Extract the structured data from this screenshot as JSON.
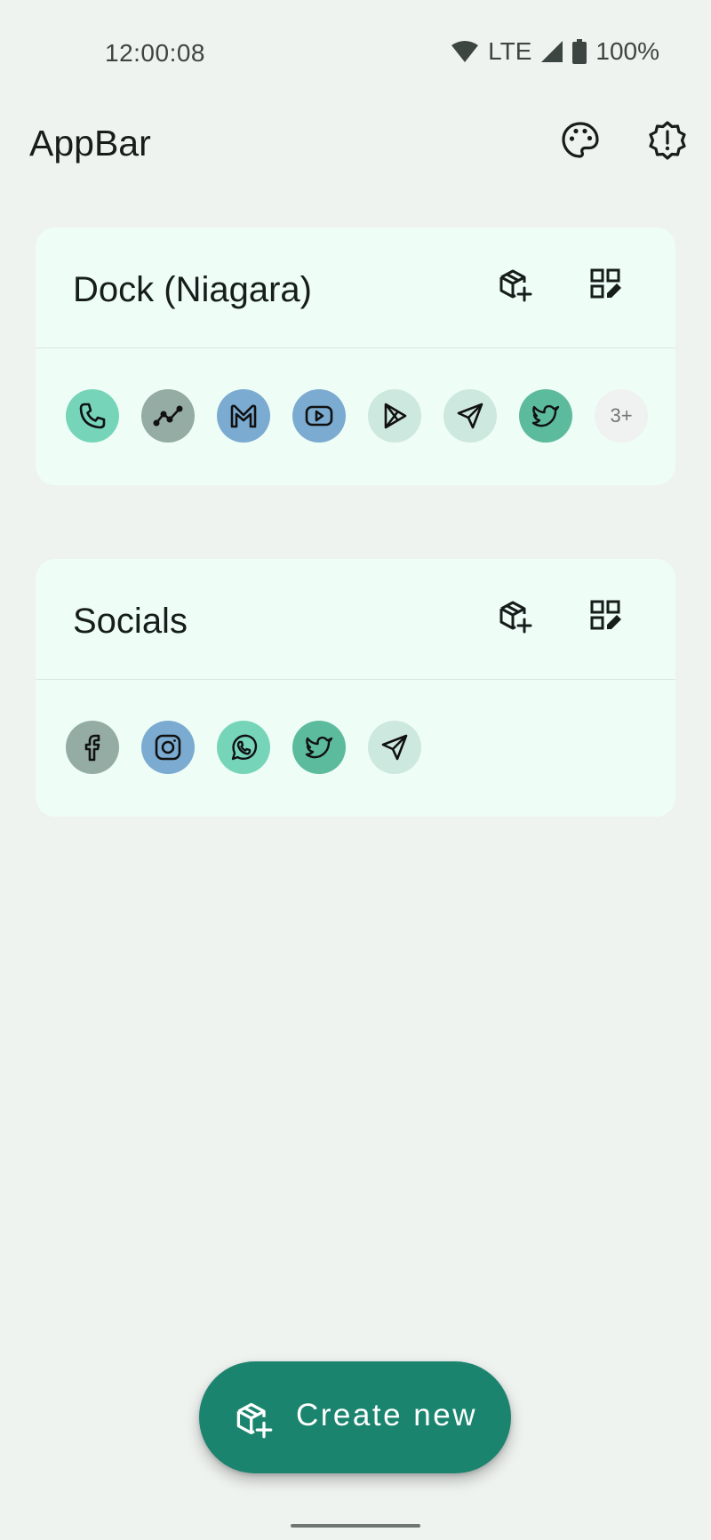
{
  "status_bar": {
    "time": "12:00:08",
    "network": "LTE",
    "battery": "100%"
  },
  "app_bar": {
    "title": "AppBar",
    "actions": [
      {
        "icon": "palette-icon"
      },
      {
        "icon": "alert-badge-icon"
      }
    ]
  },
  "groups": [
    {
      "title": "Dock (Niagara)",
      "actions": [
        {
          "icon": "add-box-icon"
        },
        {
          "icon": "edit-grid-icon"
        }
      ],
      "apps": [
        {
          "icon": "phone-icon",
          "color": "#76d5b9"
        },
        {
          "icon": "chart-line-icon",
          "color": "#94aca4"
        },
        {
          "icon": "gmail-icon",
          "color": "#7babd1"
        },
        {
          "icon": "youtube-icon",
          "color": "#7babd1"
        },
        {
          "icon": "play-store-icon",
          "color": "#cde8de"
        },
        {
          "icon": "send-icon",
          "color": "#cde8de"
        },
        {
          "icon": "twitter-icon",
          "color": "#5dbb9d"
        }
      ],
      "more": "3+"
    },
    {
      "title": "Socials",
      "actions": [
        {
          "icon": "add-box-icon"
        },
        {
          "icon": "edit-grid-icon"
        }
      ],
      "apps": [
        {
          "icon": "facebook-icon",
          "color": "#94aca4"
        },
        {
          "icon": "instagram-icon",
          "color": "#7babd1"
        },
        {
          "icon": "whatsapp-icon",
          "color": "#76d5b9"
        },
        {
          "icon": "twitter-icon",
          "color": "#5dbb9d"
        },
        {
          "icon": "send-icon",
          "color": "#cde8de"
        }
      ]
    }
  ],
  "fab": {
    "label": "Create new",
    "icon": "add-box-icon",
    "color": "#1b846e"
  }
}
